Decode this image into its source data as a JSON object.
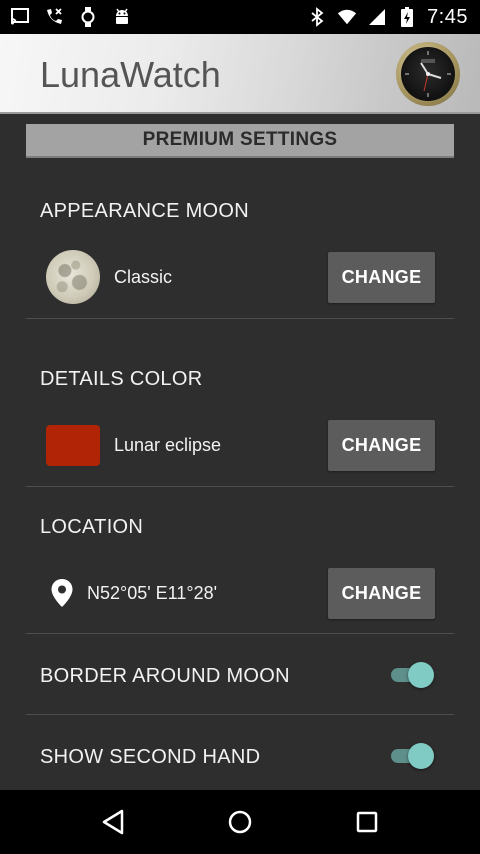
{
  "status_bar": {
    "left_icons": [
      "cast-icon",
      "phone-missed-icon",
      "watch-icon",
      "android-icon"
    ],
    "right_icons": [
      "bluetooth-icon",
      "wifi-icon",
      "signal-icon",
      "battery-icon"
    ],
    "time": "7:45"
  },
  "app": {
    "title": "LunaWatch"
  },
  "premium_banner": "PREMIUM SETTINGS",
  "sections": {
    "appearance": {
      "title": "APPEARANCE MOON",
      "value": "Classic",
      "button": "CHANGE"
    },
    "details_color": {
      "title": "DETAILS COLOR",
      "value": "Lunar eclipse",
      "color": "#b12405",
      "button": "CHANGE"
    },
    "location": {
      "title": "LOCATION",
      "value": "N52°05' E11°28'",
      "button": "CHANGE"
    },
    "border_around_moon": {
      "title": "BORDER AROUND MOON",
      "enabled": true
    },
    "show_second_hand": {
      "title": "SHOW SECOND HAND",
      "enabled": true
    }
  },
  "colors": {
    "background": "#2e2e2e",
    "button": "#5c5c5c",
    "toggle_accent": "#80cbc4",
    "banner": "#a3a3a3"
  },
  "nav_bar": [
    "back-icon",
    "home-icon",
    "recents-icon"
  ]
}
